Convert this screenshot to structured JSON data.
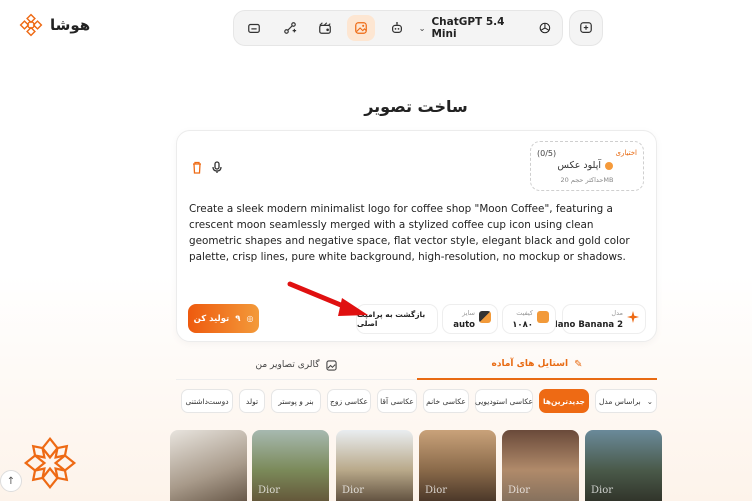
{
  "brand": {
    "name": "هوشا"
  },
  "toolbar": {
    "model_label": "ChatGPT 5.4 Mini"
  },
  "page_title": "ساخت تصویر",
  "upload": {
    "optional": "اختیاری",
    "count": "(0/5)",
    "title": "آپلود عکس",
    "max_size": "حداکثر حجم 20MB"
  },
  "prompt_text": "Create a sleek modern minimalist logo for coffee shop \"Moon Coffee\", featuring a crescent moon seamlessly merged with a stylized coffee cup icon using clean geometric shapes and negative space, flat vector style, elegant black and gold color palette, crisp lines, pure white background, high-resolution, no mockup or shadows.",
  "options": {
    "model_label": "مدل",
    "model_value": "Nano Banana 2",
    "quality_label": "کیفیت",
    "quality_value": "۱۰۸۰",
    "size_label": "سایز",
    "size_value": "auto",
    "back_label": "بازگشت به پرامپت اصلی"
  },
  "generate": {
    "label": "تولید کن",
    "cost": "۹"
  },
  "tabs": {
    "styles": "استایل های آماده",
    "gallery": "گالری تصاویر من"
  },
  "filters": {
    "by_model": "براساس مدل",
    "items": [
      "جدیدترین‌ها",
      "عکاسی استودیویی",
      "عکاسی خانم",
      "عکاسی آقا",
      "عکاسی زوج",
      "بنر و پوستر",
      "تولد",
      "دوست‌داشتنی"
    ]
  },
  "thumbnails": {
    "watermark": "Dior"
  },
  "colors": {
    "accent": "#ee6a14",
    "arrow": "#e01010"
  }
}
